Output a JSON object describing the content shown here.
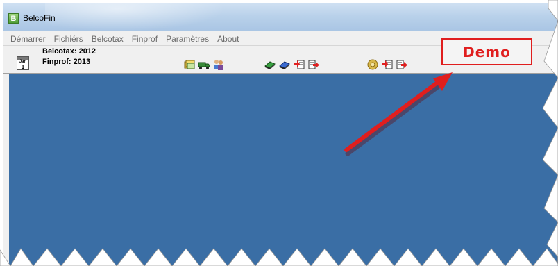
{
  "window": {
    "title": "BelcoFin",
    "icon_letter": "B"
  },
  "menu": {
    "items": [
      "Démarrer",
      "Fichiérs",
      "Belcotax",
      "Finprof",
      "Paramètres",
      "About"
    ]
  },
  "toolbar": {
    "calendar_month": "Jan",
    "calendar_day": "1",
    "belcotax_line": "Belcotax: 2012",
    "finprof_line": "Finprof: 2013"
  },
  "annotation": {
    "demo_label": "Demo",
    "color": "#e01e1e"
  },
  "colors": {
    "workspace": "#3a6ea5",
    "menu_text": "#6b6b6b"
  },
  "icons": [
    "open-folder-icon",
    "truck-icon",
    "users-icon",
    "green-disk-icon",
    "blue-disk-icon",
    "import-icon",
    "export-icon",
    "gear-icon",
    "import-icon",
    "export-icon"
  ]
}
